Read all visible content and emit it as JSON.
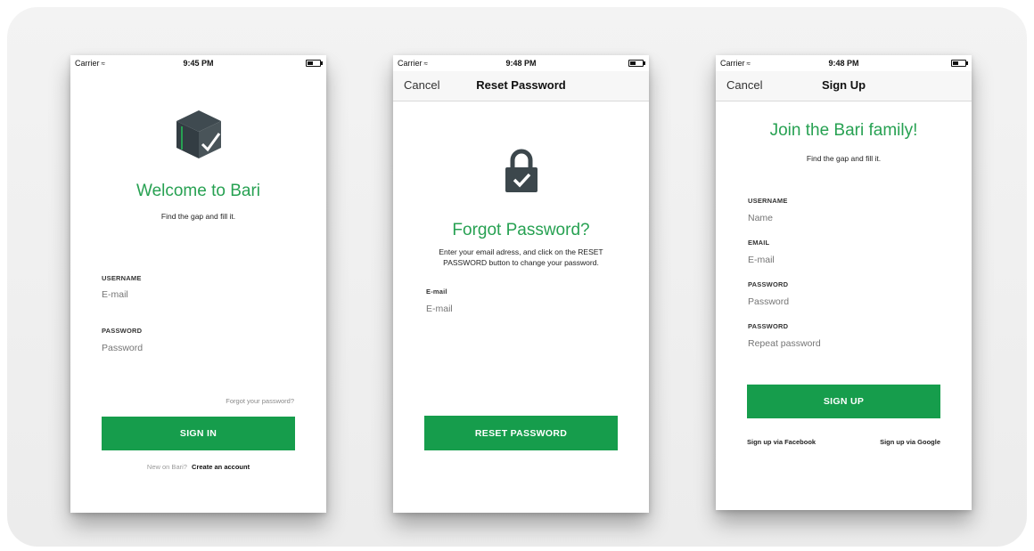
{
  "colors": {
    "accent": "#27a152",
    "button": "#169d4c",
    "placeholder": "#c4c4c4"
  },
  "screens": {
    "signin": {
      "status": {
        "carrier": "Carrier",
        "wifi_icon": "wifi-icon",
        "time": "9:45 PM"
      },
      "logo_icon": "box-logo-icon",
      "title": "Welcome to Bari",
      "subtitle": "Find the gap and fill it.",
      "username_label": "USERNAME",
      "username_placeholder": "E-mail",
      "password_label": "PASSWORD",
      "password_placeholder": "Password",
      "forgot_link": "Forgot your password?",
      "signin_button": "SIGN IN",
      "new_text": "New on Bari?",
      "create_link": "Create an account"
    },
    "reset": {
      "status": {
        "carrier": "Carrier",
        "wifi_icon": "wifi-icon",
        "time": "9:48 PM"
      },
      "nav_cancel": "Cancel",
      "nav_title": "Reset Password",
      "lock_icon": "lock-check-icon",
      "title": "Forgot Password?",
      "description_line1": "Enter your email adress, and click on the RESET",
      "description_line2": "PASSWORD button to change your password.",
      "email_label": "E-mail",
      "email_placeholder": "E-mail",
      "reset_button": "RESET PASSWORD"
    },
    "signup": {
      "status": {
        "carrier": "Carrier",
        "wifi_icon": "wifi-icon",
        "time": "9:48 PM"
      },
      "nav_cancel": "Cancel",
      "nav_title": "Sign Up",
      "title": "Join the Bari family!",
      "subtitle": "Find the gap and fill it.",
      "username_label": "USERNAME",
      "username_placeholder": "Name",
      "email_label": "EMAIL",
      "email_placeholder": "E-mail",
      "password_label": "PASSWORD",
      "password_placeholder": "Password",
      "password2_label": "PASSWORD",
      "password2_placeholder": "Repeat password",
      "signup_button": "SIGN UP",
      "facebook_link": "Sign up via Facebook",
      "google_link": "Sign up via Google"
    }
  }
}
